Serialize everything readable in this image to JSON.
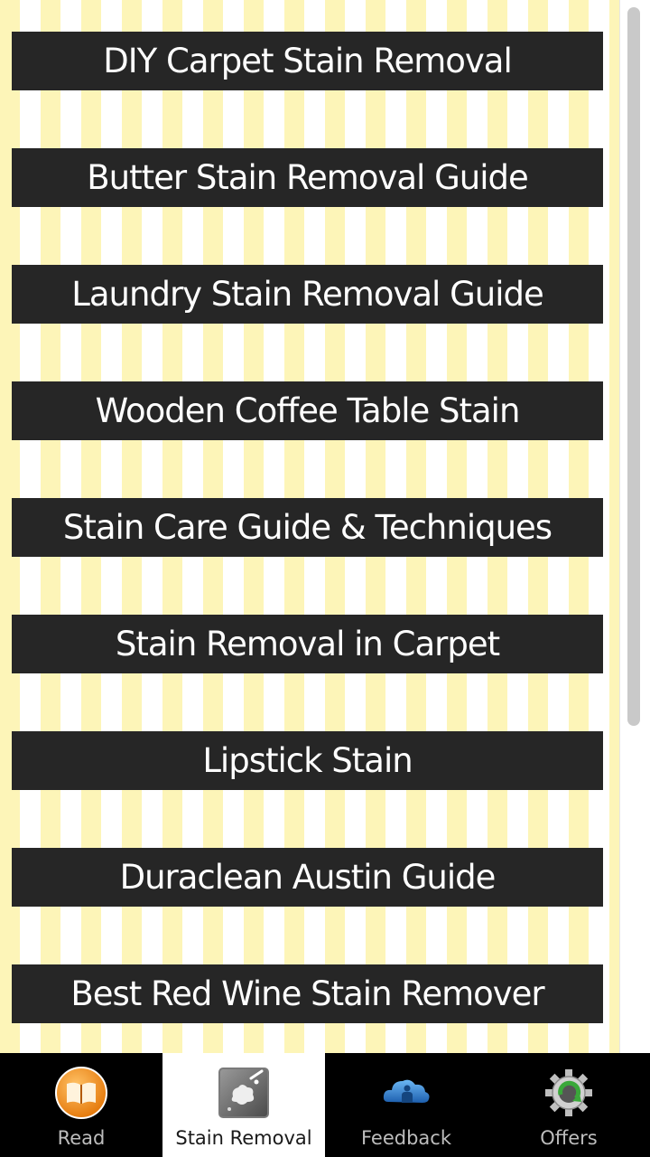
{
  "menu": {
    "items": [
      "DIY Carpet Stain Removal",
      "Butter Stain Removal Guide",
      "Laundry Stain Removal Guide",
      "Wooden Coffee Table Stain",
      "Stain Care Guide & Techniques",
      "Stain Removal in Carpet",
      "Lipstick Stain",
      "Duraclean Austin Guide",
      "Best Red Wine Stain Remover"
    ]
  },
  "tabbar": {
    "active_index": 1,
    "tabs": [
      {
        "label": "Read",
        "icon": "book-icon"
      },
      {
        "label": "Stain Removal",
        "icon": "stain-icon"
      },
      {
        "label": "Feedback",
        "icon": "cloud-icon"
      },
      {
        "label": "Offers",
        "icon": "refresh-gear-icon"
      }
    ]
  },
  "colors": {
    "button_bg": "#262626",
    "button_text": "#ffffff",
    "stripe_yellow": "#fdf5b8",
    "tabbar_bg": "#000000",
    "active_tab_bg": "#ffffff",
    "read_icon_orange": "#f28c1c",
    "feedback_icon_blue": "#2f86d6",
    "offers_icon_green": "#3aa83a"
  }
}
